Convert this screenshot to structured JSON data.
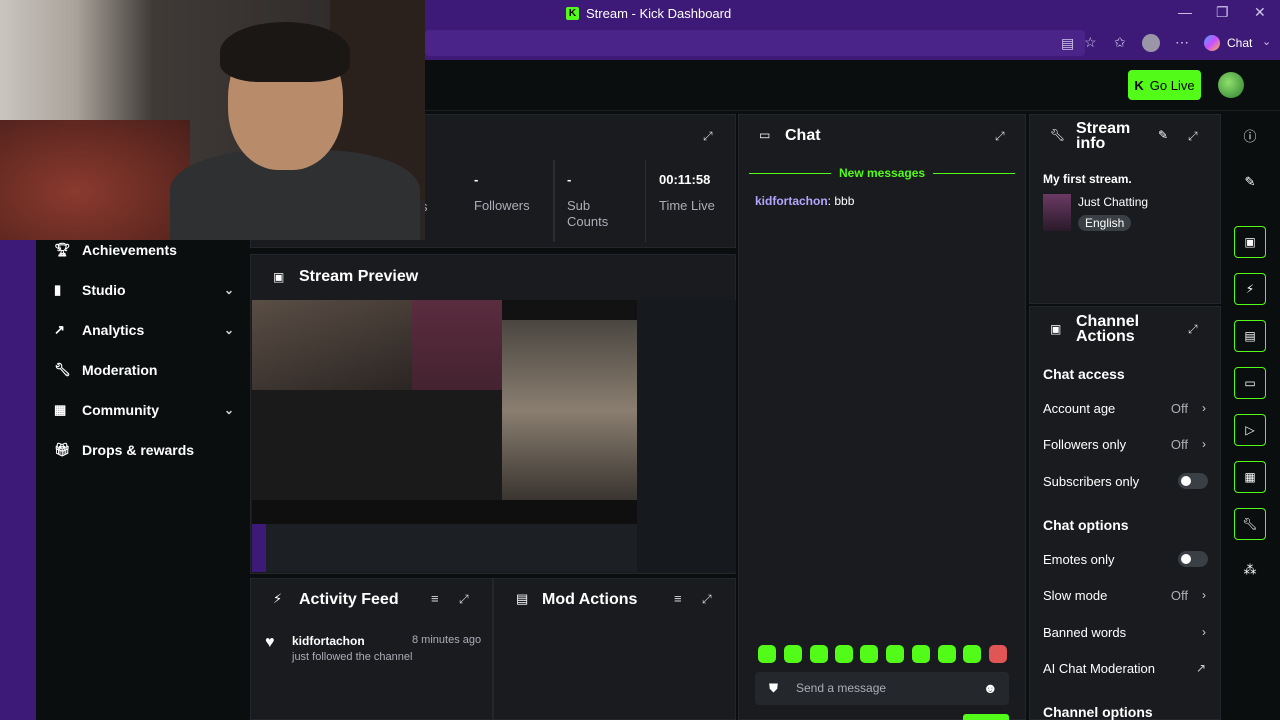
{
  "window": {
    "title": "Stream - Kick Dashboard",
    "chat_button": "Chat"
  },
  "header": {
    "go_live": "Go Live"
  },
  "sidebar": {
    "items": [
      {
        "label": "Achievements",
        "has_chevron": false
      },
      {
        "label": "Studio",
        "has_chevron": true
      },
      {
        "label": "Analytics",
        "has_chevron": true
      },
      {
        "label": "Moderation",
        "has_chevron": false
      },
      {
        "label": "Community",
        "has_chevron": true
      },
      {
        "label": "Drops & rewards",
        "has_chevron": false
      }
    ]
  },
  "stats": {
    "partial_label": "s",
    "followers_value": "-",
    "followers_label": "Followers",
    "subs_value": "-",
    "subs_label": "Sub Counts",
    "time_value": "00:11:58",
    "time_label": "Time Live"
  },
  "preview": {
    "title": "Stream Preview"
  },
  "activity": {
    "title": "Activity Feed",
    "items": [
      {
        "user": "kidfortachon",
        "time": "8 minutes ago",
        "text": "just followed the channel"
      }
    ]
  },
  "mod_actions": {
    "title": "Mod Actions"
  },
  "chat": {
    "title": "Chat",
    "divider": "New messages",
    "messages": [
      {
        "user": "kidfortachon",
        "text": "bbb"
      }
    ],
    "input_placeholder": "Send a message"
  },
  "stream_info": {
    "title": "Stream info",
    "stream_title": "My first stream.",
    "category": "Just Chatting",
    "language": "English"
  },
  "channel_actions": {
    "title": "Channel Actions",
    "chat_access": "Chat access",
    "account_age_label": "Account age",
    "account_age_value": "Off",
    "followers_only_label": "Followers only",
    "followers_only_value": "Off",
    "subscribers_only_label": "Subscribers only",
    "chat_options": "Chat options",
    "emotes_only_label": "Emotes only",
    "slow_mode_label": "Slow mode",
    "slow_mode_value": "Off",
    "banned_words_label": "Banned words",
    "ai_mod_label": "AI Chat Moderation",
    "channel_options": "Channel options"
  },
  "colors": {
    "accent": "#53fc18",
    "chrome": "#3d1a78",
    "panel": "#191b1f",
    "bg": "#0b0e0f"
  }
}
